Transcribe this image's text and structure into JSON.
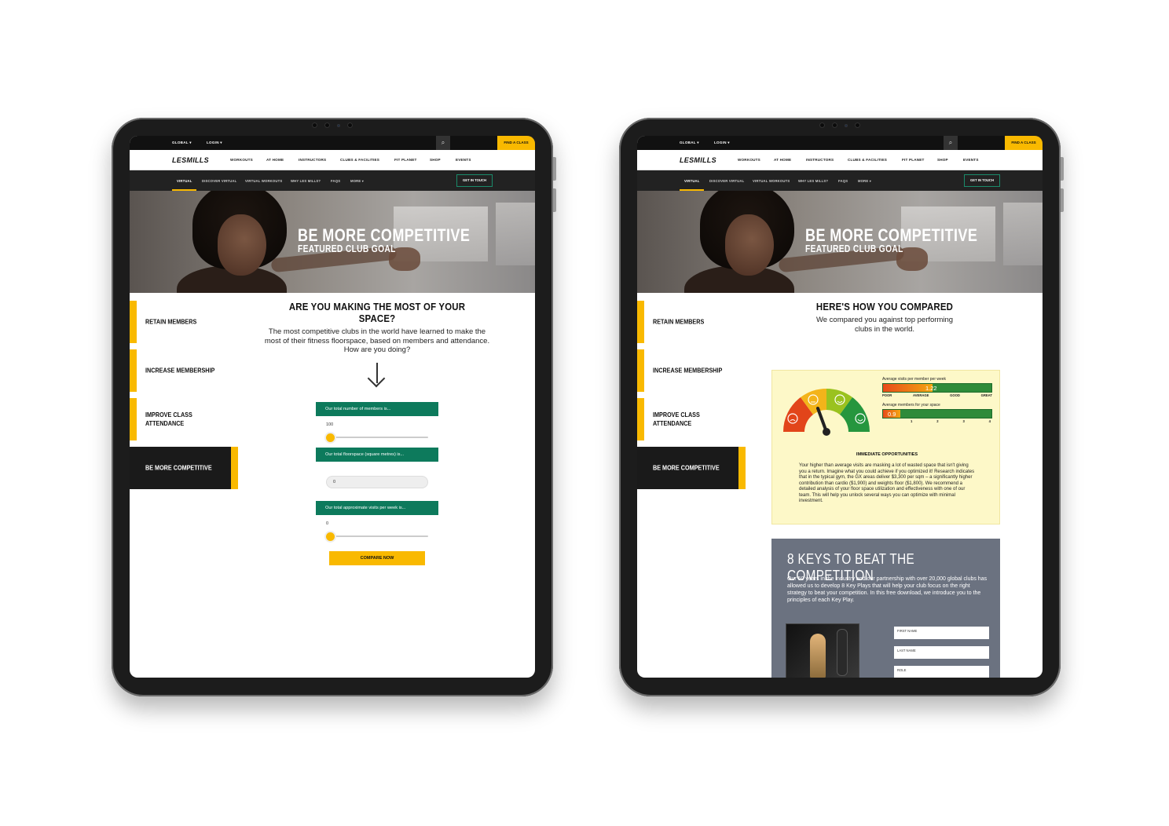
{
  "header": {
    "global_label": "GLOBAL",
    "login_label": "LOGIN",
    "search_icon": "search-icon",
    "find_class_label": "FIND A CLASS",
    "logo_text": "LESMILLS",
    "nav_items": [
      "WORKOUTS",
      "AT HOME",
      "INSTRUCTORS",
      "CLUBS & FACILITIES",
      "FIT PLANET",
      "SHOP",
      "EVENTS"
    ],
    "subnav_items": [
      "VIRTUAL",
      "DISCOVER VIRTUAL",
      "VIRTUAL WORKOUTS",
      "WHY LES MILLS?",
      "FAQS",
      "MORE"
    ],
    "get_in_touch_label": "GET IN TOUCH"
  },
  "hero": {
    "title": "BE MORE COMPETITIVE",
    "subtitle": "FEATURED CLUB GOAL"
  },
  "goals": [
    "RETAIN MEMBERS",
    "INCREASE MEMBERSHIP",
    "IMPROVE CLASS ATTENDANCE",
    "BE MORE COMPETITIVE"
  ],
  "left_screen": {
    "heading": "ARE YOU MAKING THE MOST OF YOUR SPACE?",
    "intro": "The most competitive clubs in the world have learned to make the most of their fitness floorspace, based on members and attendance. How are you doing?",
    "members_label": "Our total number of members is...",
    "members_value": "100",
    "floorspace_label": "Our total floorspace (square metres) is...",
    "floorspace_value": "0",
    "visits_label": "Our total approximate visits per week is...",
    "visits_value": "0",
    "compare_button": "COMPARE NOW",
    "members_slider_level": 0.0,
    "visits_slider_level": 0.0
  },
  "right_screen": {
    "heading": "HERE'S HOW YOU COMPARED",
    "intro": "We compared you against top performing clubs in the world.",
    "visits_caption": "Average visits per member per week",
    "visits_value": "1.22",
    "visits_scale": [
      "POOR",
      "AVERAGE",
      "GOOD",
      "GREAT"
    ],
    "members_caption": "Average members for your space",
    "members_value": "0.9",
    "members_scale": [
      "1",
      "2",
      "3",
      "4"
    ],
    "visits_fill_level": 0.46,
    "members_fill_level": 0.16,
    "gauge_level": 0.45,
    "opportunities_heading": "IMMEDIATE OPPORTUNITIES",
    "opportunities_text": "Your higher than average visits are masking a lot of wasted space that isn't giving you a return. Imagine what you could achieve if you optimized it! Research indicates that in the typical gym, the GX areas deliver $3,300 per sqm – a significantly higher contribution than cardio ($1,900) and weights floor ($1,800). We recommend a detailed analysis of your floor space utilization and effectiveness with one of our team. This will help you unlock several ways you can optimize with minimal investment.",
    "keys_heading": "8 KEYS TO BEAT THE COMPETITION",
    "keys_text": "Our 50 years in the industry and our partnership with over 20,000 global clubs has allowed us to develop 8 Key Plays that will help your club focus on the right strategy to beat your competition. In this free download, we introduce you to the principles of each Key Play.",
    "form_fields": [
      "FIRST NAME",
      "LAST NAME",
      "ROLE"
    ]
  },
  "colors": {
    "brand_yellow": "#f9b900",
    "brand_green": "#0d7a5c",
    "dark": "#1a1a1a",
    "panel_bg": "#fdf8c8",
    "keys_bg": "#6b7280"
  }
}
